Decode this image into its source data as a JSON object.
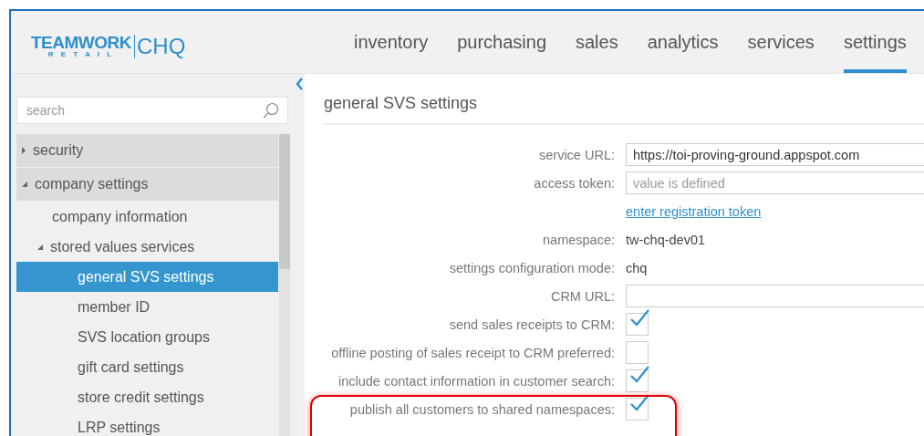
{
  "logo": {
    "wordmark": "TEAMWORK",
    "subtitle": "R E T A I L",
    "product": "CHQ"
  },
  "nav": [
    {
      "label": "inventory",
      "selected": false
    },
    {
      "label": "purchasing",
      "selected": false
    },
    {
      "label": "sales",
      "selected": false
    },
    {
      "label": "analytics",
      "selected": false
    },
    {
      "label": "services",
      "selected": false
    },
    {
      "label": "settings",
      "selected": true
    }
  ],
  "sidebar": {
    "search": {
      "placeholder": "search"
    },
    "items": [
      {
        "label": "security",
        "expanded": false,
        "selected": false
      },
      {
        "label": "company settings",
        "expanded": true,
        "selected": false,
        "children": [
          {
            "label": "company information",
            "selected": false
          },
          {
            "label": "stored values services",
            "expanded": true,
            "selected": false,
            "children": [
              {
                "label": "general SVS settings",
                "selected": true
              },
              {
                "label": "member ID",
                "selected": false
              },
              {
                "label": "SVS location groups",
                "selected": false
              },
              {
                "label": "gift card settings",
                "selected": false
              },
              {
                "label": "store credit settings",
                "selected": false
              },
              {
                "label": "LRP settings",
                "selected": false
              }
            ]
          }
        ]
      }
    ]
  },
  "content": {
    "title": "general SVS settings",
    "fields": [
      {
        "kind": "input",
        "label": "service URL:",
        "value": "https://toi-proving-ground.appspot.com"
      },
      {
        "kind": "input",
        "label": "access token:",
        "placeholder": "value is defined"
      },
      {
        "kind": "link",
        "text": "enter registration token"
      },
      {
        "kind": "text",
        "label": "namespace:",
        "value": "tw-chq-dev01"
      },
      {
        "kind": "text",
        "label": "settings configuration mode:",
        "value": "chq"
      },
      {
        "kind": "input",
        "label": "CRM URL:"
      },
      {
        "kind": "checkbox",
        "label": "send sales receipts to CRM:",
        "checked": true
      },
      {
        "kind": "checkbox",
        "label": "offline posting of sales receipt to CRM preferred:",
        "checked": false
      },
      {
        "kind": "checkbox",
        "label": "include contact information in customer search:",
        "checked": true
      },
      {
        "kind": "checkbox",
        "label": "publish all customers to shared namespaces:",
        "checked": true,
        "highlighted": true
      }
    ]
  }
}
